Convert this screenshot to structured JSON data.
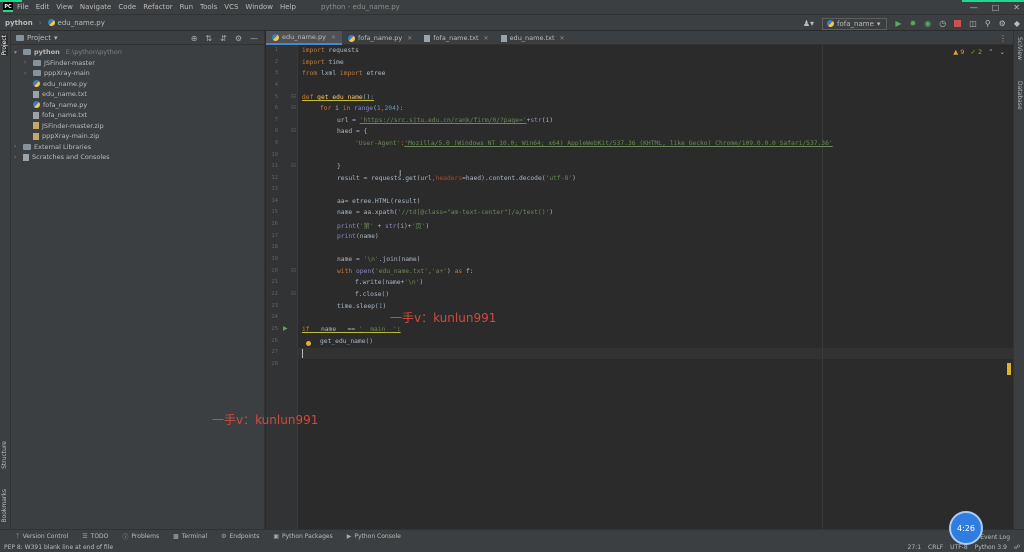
{
  "menubar": {
    "items": [
      "File",
      "Edit",
      "View",
      "Navigate",
      "Code",
      "Refactor",
      "Run",
      "Tools",
      "VCS",
      "Window",
      "Help"
    ],
    "window_title": "python - edu_name.py",
    "app_logo": "PC"
  },
  "navbar": {
    "project": "python",
    "file": "edu_name.py",
    "run_config": "fofa_name"
  },
  "project_panel": {
    "title": "Project",
    "tree": [
      {
        "name": "python",
        "extra": "E:\\python\\python",
        "type": "folder",
        "indent": 0,
        "expanded": true,
        "bold": true
      },
      {
        "name": "JSFinder-master",
        "extra": "",
        "type": "folder",
        "indent": 1,
        "expanded": false,
        "bold": false
      },
      {
        "name": "pppXray-main",
        "extra": "",
        "type": "folder",
        "indent": 1,
        "expanded": false,
        "bold": false
      },
      {
        "name": "edu_name.py",
        "extra": "",
        "type": "py",
        "indent": 1,
        "expanded": null,
        "bold": false
      },
      {
        "name": "edu_name.txt",
        "extra": "",
        "type": "txt",
        "indent": 1,
        "expanded": null,
        "bold": false
      },
      {
        "name": "fofa_name.py",
        "extra": "",
        "type": "py",
        "indent": 1,
        "expanded": null,
        "bold": false
      },
      {
        "name": "fofa_name.txt",
        "extra": "",
        "type": "txt",
        "indent": 1,
        "expanded": null,
        "bold": false
      },
      {
        "name": "JSFinder-master.zip",
        "extra": "",
        "type": "zip",
        "indent": 1,
        "expanded": null,
        "bold": false
      },
      {
        "name": "pppXray-main.zip",
        "extra": "",
        "type": "zip",
        "indent": 1,
        "expanded": null,
        "bold": false
      },
      {
        "name": "External Libraries",
        "extra": "",
        "type": "lib",
        "indent": 0,
        "expanded": false,
        "bold": false
      },
      {
        "name": "Scratches and Consoles",
        "extra": "",
        "type": "scratch",
        "indent": 0,
        "expanded": false,
        "bold": false
      }
    ]
  },
  "left_strip": {
    "project": "Project",
    "structure": "Structure",
    "bookmarks": "Bookmarks"
  },
  "right_strip": {
    "sciview": "SciView",
    "database": "Database"
  },
  "tabs": [
    {
      "label": "edu_name.py",
      "type": "py",
      "active": true
    },
    {
      "label": "fofa_name.py",
      "type": "py",
      "active": false
    },
    {
      "label": "fofa_name.txt",
      "type": "txt",
      "active": false
    },
    {
      "label": "edu_name.txt",
      "type": "txt",
      "active": false
    }
  ],
  "editor": {
    "inspections": {
      "warnings": "9",
      "weak": "2"
    },
    "line_numbers": [
      "1",
      "2",
      "3",
      "4",
      "5",
      "6",
      "7",
      "8",
      "9",
      "10",
      "11",
      "12",
      "13",
      "14",
      "15",
      "16",
      "17",
      "18",
      "19",
      "20",
      "21",
      "22",
      "23",
      "24",
      "25",
      "26",
      "27",
      "28"
    ],
    "code": {
      "l1": [
        "import",
        " requests"
      ],
      "l2": [
        "import",
        " time"
      ],
      "l3": [
        "from",
        " lxml ",
        "import",
        " etree"
      ],
      "l5": [
        "def",
        " ",
        "get_edu_name",
        "():"
      ],
      "l6": [
        "for",
        " i ",
        "in",
        " ",
        "range",
        "(",
        "1",
        ",",
        "204",
        "):"
      ],
      "l7": [
        "url = ",
        "'https://src.sjtu.edu.cn/rank/firm/0/?page='",
        "+",
        "str",
        "(i)"
      ],
      "l8": [
        "haed = {"
      ],
      "l9": [
        "'User-Agent'",
        ":",
        "'Mozilla/5.0 (Windows NT 10.0; Win64; x64) AppleWebKit/537.36 (KHTML, like Gecko) Chrome/109.0.0.0 Safari/537.36'"
      ],
      "l11": [
        "}"
      ],
      "l12": [
        "result = requests.get(url",
        ",",
        "headers",
        "=haed).content.decode(",
        "'utf-8'",
        ")"
      ],
      "l14": [
        "aa= etree.HTML(result)"
      ],
      "l15": [
        "name = aa.xpath(",
        "'//td[@class=\"am-text-center\"]/a/text()'",
        ")"
      ],
      "l16": [
        "print",
        "(",
        "'第'",
        " + ",
        "str",
        "(i)+",
        "'页'",
        ")"
      ],
      "l17": [
        "print",
        "(name)"
      ],
      "l19": [
        "name = ",
        "'\\n'",
        ".join(name)"
      ],
      "l20": [
        "with",
        " ",
        "open",
        "(",
        "'edu_name.txt'",
        ",",
        "'a+'",
        ") ",
        "as",
        " f:"
      ],
      "l21": [
        "f.write(name+",
        "'\\n'",
        ")"
      ],
      "l22": [
        "f.close()"
      ],
      "l23": [
        "time.sleep(",
        "1",
        ")"
      ],
      "l25": [
        "if",
        " __name__ == ",
        "'__main__'",
        ":"
      ],
      "l26": [
        "get_edu_name()"
      ]
    },
    "watermark": "一手v：kunlun991"
  },
  "bottom_tools": [
    "Version Control",
    "TODO",
    "Problems",
    "Terminal",
    "Endpoints",
    "Python Packages",
    "Python Console"
  ],
  "event_log": "Event Log",
  "status": {
    "message": "PEP 8: W391 blank line at end of file",
    "position": "27:1",
    "line_sep": "CRLF",
    "encoding": "UTF-8",
    "interpreter": "Python 3.9"
  },
  "player": {
    "counter": "4:26"
  },
  "colors": {
    "accent": "#4a88c7",
    "keyword": "#cc7832",
    "string": "#6a8759",
    "number": "#6897bb",
    "watermark": "#d04a3a",
    "jetbrains_green": "#21d789"
  }
}
